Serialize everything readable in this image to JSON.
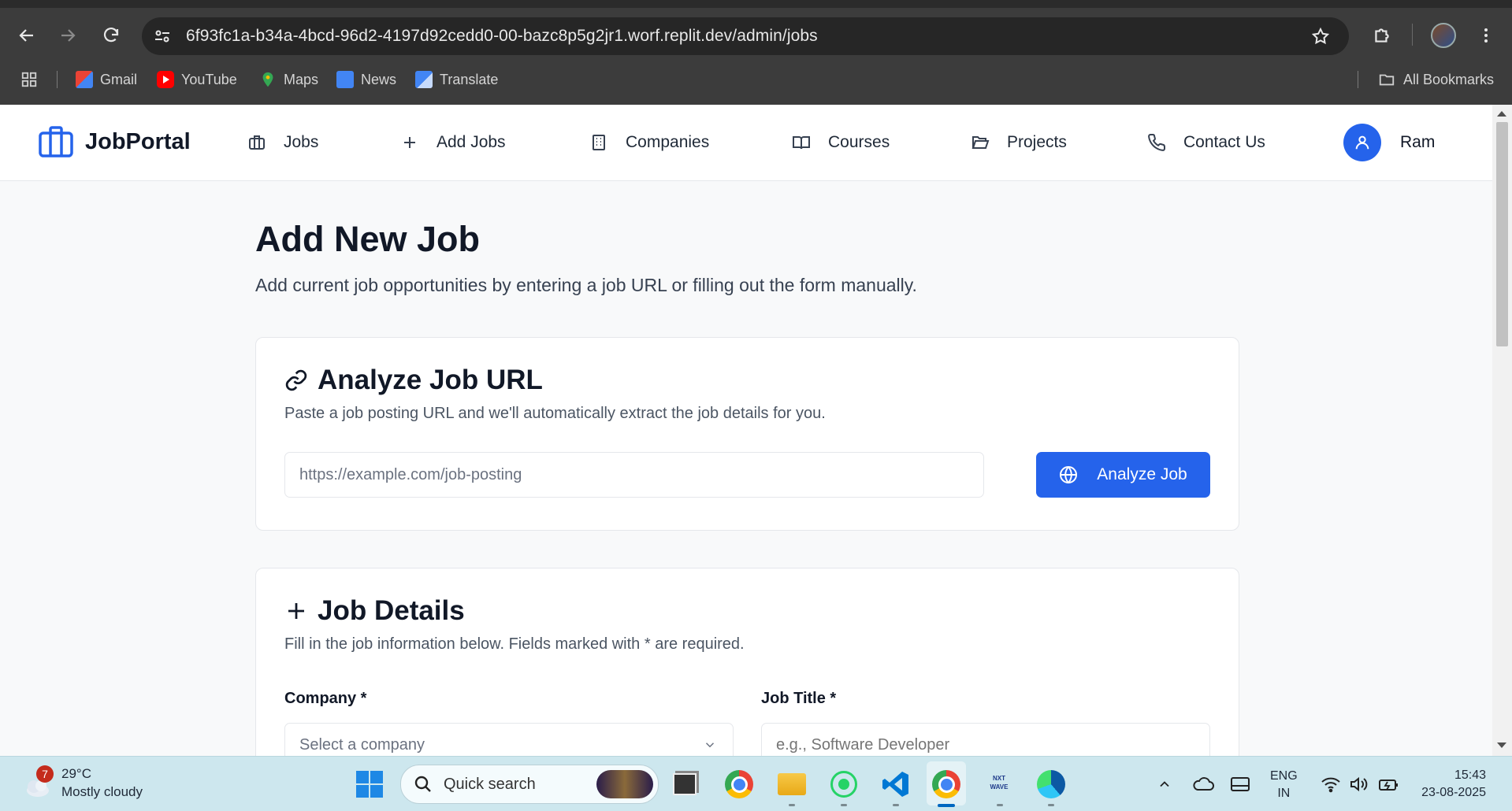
{
  "browser": {
    "url": "6f93fc1a-b34a-4bcd-96d2-4197d92cedd0-00-bazc8p5g2jr1.worf.replit.dev/admin/jobs",
    "bookmarks": [
      {
        "label": "Gmail",
        "icon": "gmail-icon",
        "color": "#ea4335"
      },
      {
        "label": "YouTube",
        "icon": "youtube-icon",
        "color": "#ff0000"
      },
      {
        "label": "Maps",
        "icon": "maps-icon",
        "color": "#34a853"
      },
      {
        "label": "News",
        "icon": "news-icon",
        "color": "#4285f4"
      },
      {
        "label": "Translate",
        "icon": "translate-icon",
        "color": "#4285f4"
      }
    ],
    "all_bookmarks": "All Bookmarks"
  },
  "app": {
    "logo": "JobPortal",
    "nav": [
      {
        "label": "Jobs",
        "icon": "briefcase-icon"
      },
      {
        "label": "Add Jobs",
        "icon": "plus-icon"
      },
      {
        "label": "Companies",
        "icon": "building-icon"
      },
      {
        "label": "Courses",
        "icon": "book-icon"
      },
      {
        "label": "Projects",
        "icon": "folder-icon"
      },
      {
        "label": "Contact Us",
        "icon": "phone-icon"
      }
    ],
    "user": "Ram",
    "accent": "#2563eb"
  },
  "page": {
    "title": "Add New Job",
    "subtitle": "Add current job opportunities by entering a job URL or filling out the form manually."
  },
  "analyze_card": {
    "title": "Analyze Job URL",
    "description": "Paste a job posting URL and we'll automatically extract the job details for you.",
    "url_placeholder": "https://example.com/job-posting",
    "button_label": "Analyze Job"
  },
  "details_card": {
    "title": "Job Details",
    "description": "Fill in the job information below. Fields marked with * are required.",
    "company_label": "Company *",
    "company_placeholder": "Select a company",
    "job_title_label": "Job Title *",
    "job_title_placeholder": "e.g., Software Developer"
  },
  "taskbar": {
    "weather_badge": "7",
    "temperature": "29°C",
    "condition": "Mostly cloudy",
    "search_placeholder": "Quick search",
    "lang_top": "ENG",
    "lang_bottom": "IN",
    "time": "15:43",
    "date": "23-08-2025"
  }
}
